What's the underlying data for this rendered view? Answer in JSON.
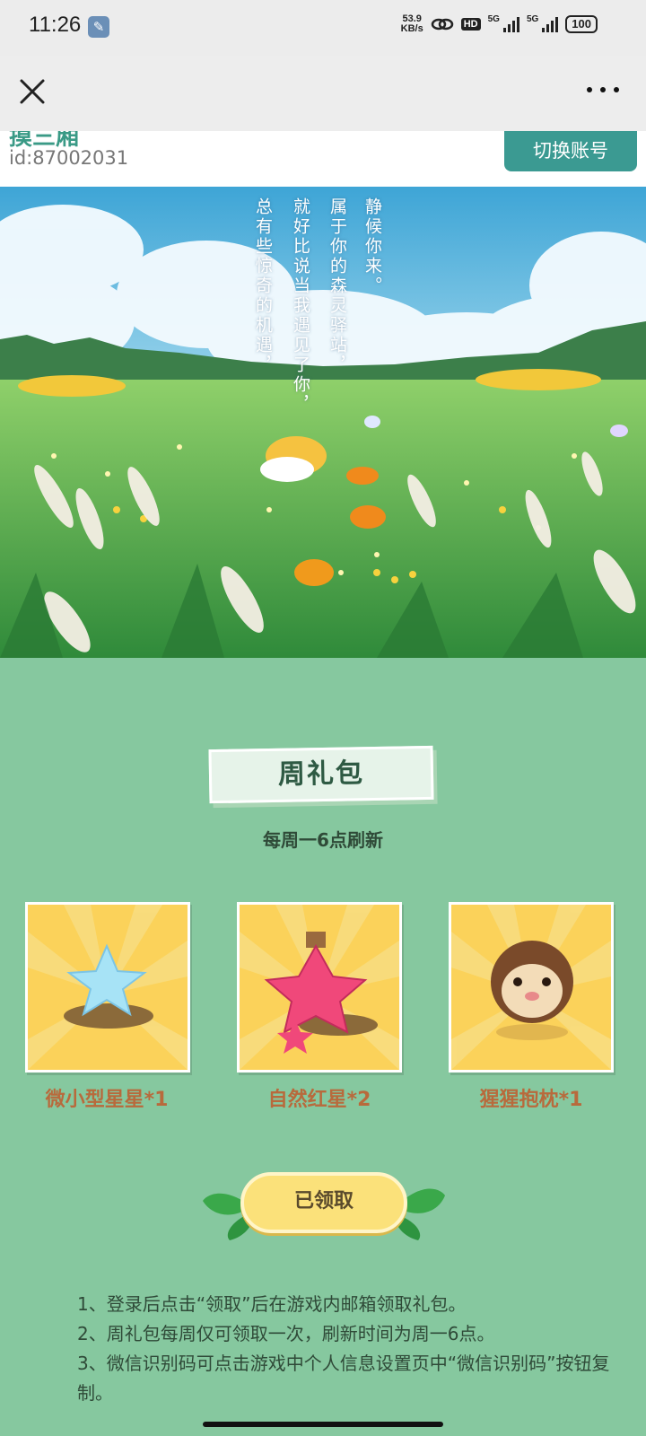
{
  "status_bar": {
    "time": "11:26",
    "net_speed_value": "53.9",
    "net_speed_unit": "KB/s",
    "hd_label": "HD",
    "signal1_label": "5G",
    "signal2_label": "5G",
    "battery": "100"
  },
  "account": {
    "name": "摸三厢",
    "id_text": "id:87002031",
    "switch_label": "切换账号"
  },
  "banner": {
    "poem_lines": [
      "静候你来。",
      "属于你的森灵驿站，",
      "就好比说当我遇见了你，",
      "总有些惊奇的机遇，"
    ]
  },
  "gift": {
    "title": "周礼包",
    "refresh_note": "每周一6点刷新",
    "items": [
      {
        "name": "微小型星星*1",
        "icon": "blue-star-icon"
      },
      {
        "name": "自然红星*2",
        "icon": "red-star-bottle-icon"
      },
      {
        "name": "猩猩抱枕*1",
        "icon": "monkey-pillow-icon"
      }
    ],
    "claim_label": "已领取"
  },
  "rules": [
    "1、登录后点击“领取”后在游戏内邮箱领取礼包。",
    "2、周礼包每周仅可领取一次，刷新时间为周一6点。",
    "3、微信识别码可点击游戏中个人信息设置页中“微信识别码”按钮复制。"
  ],
  "colors": {
    "page_bg": "#86c89f",
    "accent_button": "#3b9a92",
    "item_name": "#b86a3c",
    "claimed_button": "#fbe17a"
  }
}
